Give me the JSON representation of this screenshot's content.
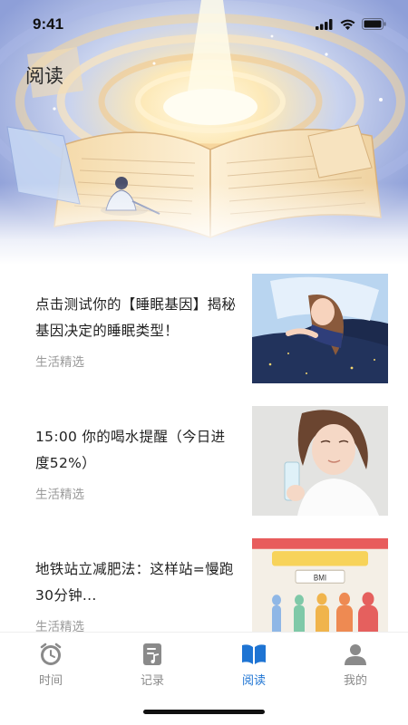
{
  "status_bar": {
    "time": "9:41"
  },
  "header": {
    "title": "阅读"
  },
  "articles": [
    {
      "title": "点击测试你的【睡眠基因】揭秘基因决定的睡眠类型！",
      "tag": "生活精选",
      "thumb_icon": "sleeping-woman-illustration"
    },
    {
      "title": "15:00 你的喝水提醒（今日进度52%）",
      "tag": "生活精选",
      "thumb_icon": "woman-drinking-water-photo"
    },
    {
      "title": "地铁站立减肥法：这样站=慢跑30分钟...",
      "tag": "生活精选",
      "thumb_icon": "bmi-body-chart",
      "thumb_label": "BMI"
    }
  ],
  "tab_bar": {
    "tabs": [
      {
        "label": "时间",
        "icon": "clock-icon",
        "active": false
      },
      {
        "label": "记录",
        "icon": "note-icon",
        "active": false
      },
      {
        "label": "阅读",
        "icon": "book-icon",
        "active": true
      },
      {
        "label": "我的",
        "icon": "user-icon",
        "active": false
      }
    ]
  },
  "colors": {
    "accent": "#1e74d3",
    "inactive": "#8a8a8a",
    "tag": "#9a9a9a"
  }
}
